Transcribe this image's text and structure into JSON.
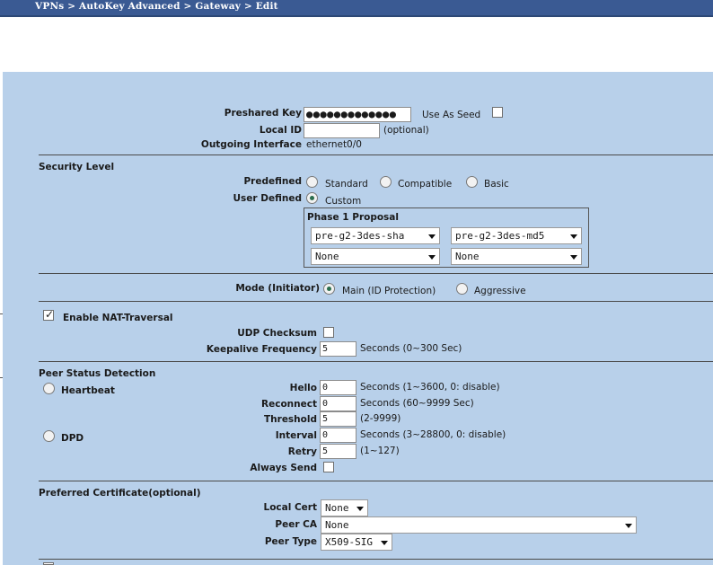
{
  "breadcrumb": "VPNs > AutoKey Advanced > Gateway > Edit",
  "preshared": {
    "label": "Preshared Key",
    "value": "●●●●●●●●●●●●●",
    "seed_label": "Use As Seed"
  },
  "local_id": {
    "label": "Local ID",
    "value": "",
    "hint": "(optional)"
  },
  "outgoing": {
    "label": "Outgoing Interface",
    "value": "ethernet0/0"
  },
  "security": {
    "title": "Security Level",
    "predefined_label": "Predefined",
    "options": [
      "Standard",
      "Compatible",
      "Basic"
    ],
    "user_defined_label": "User Defined",
    "custom": "Custom",
    "phase1_title": "Phase 1 Proposal",
    "proposals": [
      "pre-g2-3des-sha",
      "pre-g2-3des-md5",
      "None",
      "None"
    ]
  },
  "mode": {
    "label": "Mode (Initiator)",
    "main": "Main (ID Protection)",
    "aggressive": "Aggressive"
  },
  "nat": {
    "label": "Enable NAT-Traversal",
    "checked": true,
    "udp_label": "UDP Checksum",
    "keepalive_label": "Keepalive Frequency",
    "keepalive_value": "5",
    "keepalive_hint": "Seconds (0~300 Sec)"
  },
  "peer": {
    "title": "Peer Status Detection",
    "heartbeat": "Heartbeat",
    "dpd": "DPD",
    "hello_label": "Hello",
    "hello_value": "0",
    "hello_hint": "Seconds (1~3600, 0: disable)",
    "reconnect_label": "Reconnect",
    "reconnect_value": "0",
    "reconnect_hint": "Seconds (60~9999 Sec)",
    "threshold_label": "Threshold",
    "threshold_value": "5",
    "threshold_hint": "(2-9999)",
    "interval_label": "Interval",
    "interval_value": "0",
    "interval_hint": "Seconds (3~28800, 0: disable)",
    "retry_label": "Retry",
    "retry_value": "5",
    "retry_hint": "(1~127)",
    "always_label": "Always Send"
  },
  "cert": {
    "title": "Preferred Certificate(optional)",
    "local_label": "Local Cert",
    "local_value": "None",
    "ca_label": "Peer CA",
    "ca_value": "None",
    "type_label": "Peer Type",
    "type_value": "X509-SIG"
  },
  "colors": {
    "topbar": "#3a5a93",
    "panel": "#b8d0ea",
    "radio_dot": "#2a6e4e"
  }
}
